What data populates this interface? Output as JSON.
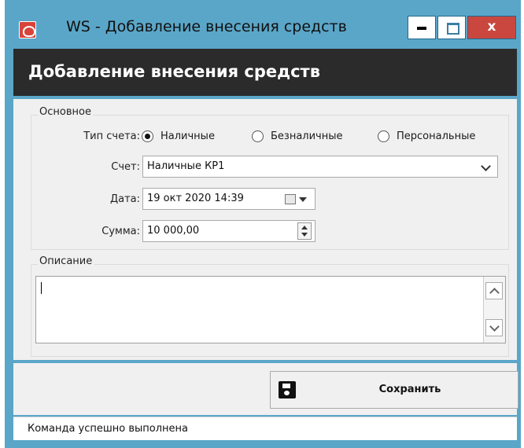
{
  "window": {
    "title": "WS - Добавление внесения средств",
    "close_glyph": "x"
  },
  "header": {
    "title": "Добавление внесения средств"
  },
  "main_group": {
    "label": "Основное",
    "account_type": {
      "label": "Тип счета:",
      "options": [
        "Наличные",
        "Безналичные",
        "Персональные"
      ],
      "selected": "Наличные"
    },
    "account": {
      "label": "Счет:",
      "value": "Наличные КР1"
    },
    "date": {
      "label": "Дата:",
      "value": "19 окт  2020  14:39"
    },
    "amount": {
      "label": "Сумма:",
      "value": "10 000,00"
    }
  },
  "description": {
    "label": "Описание",
    "value": ""
  },
  "footer": {
    "save_label": "Сохранить"
  },
  "status": {
    "text": "Команда успешно выполнена"
  }
}
